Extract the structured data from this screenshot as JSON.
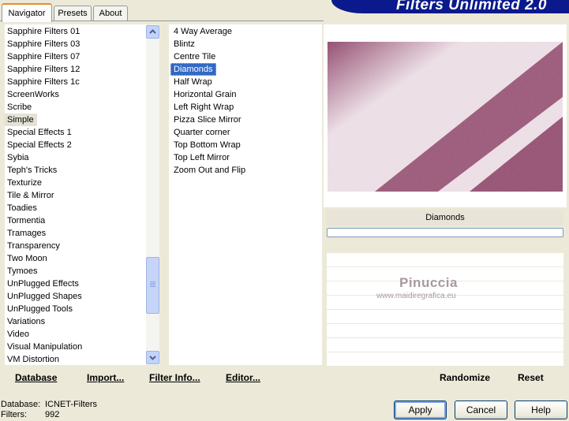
{
  "tabs": [
    {
      "label": "Navigator",
      "active": true
    },
    {
      "label": "Presets",
      "active": false
    },
    {
      "label": "About",
      "active": false
    }
  ],
  "title": "Filters Unlimited 2.0",
  "categories": [
    "Sapphire Filters 01",
    "Sapphire Filters 03",
    "Sapphire Filters 07",
    "Sapphire Filters 12",
    "Sapphire Filters 1c",
    "ScreenWorks",
    "Scribe",
    "Simple",
    "Special Effects 1",
    "Special Effects 2",
    "Sybia",
    "Teph's Tricks",
    "Texturize",
    "Tile & Mirror",
    "Toadies",
    "Tormentia",
    "Tramages",
    "Transparency",
    "Two Moon",
    "Tymoes",
    "UnPlugged Effects",
    "UnPlugged Shapes",
    "UnPlugged Tools",
    "Variations",
    "Video",
    "Visual Manipulation",
    "VM Distortion"
  ],
  "selected_category": "Simple",
  "filters": [
    "4 Way Average",
    "Blintz",
    "Centre Tile",
    "Diamonds",
    "Half Wrap",
    "Horizontal Grain",
    "Left Right Wrap",
    "Pizza Slice Mirror",
    "Quarter corner",
    "Top Bottom Wrap",
    "Top Left Mirror",
    "Zoom Out and Flip"
  ],
  "selected_filter": "Diamonds",
  "preview_colors": {
    "dark": "#8b3a62",
    "light": "#f3e4ec"
  },
  "filter_name_label": "Diamonds",
  "watermark": {
    "name": "Pinuccia",
    "url": "www.maidiregrafica.eu"
  },
  "buttons": {
    "database": "Database",
    "import": "Import...",
    "filter_info": "Filter Info...",
    "editor": "Editor...",
    "randomize": "Randomize",
    "reset": "Reset",
    "apply": "Apply",
    "cancel": "Cancel",
    "help": "Help"
  },
  "status": {
    "database_label": "Database:",
    "database_value": "ICNET-Filters",
    "filters_label": "Filters:",
    "filters_value": "992"
  },
  "scrollbar": {
    "position": 0.85
  }
}
